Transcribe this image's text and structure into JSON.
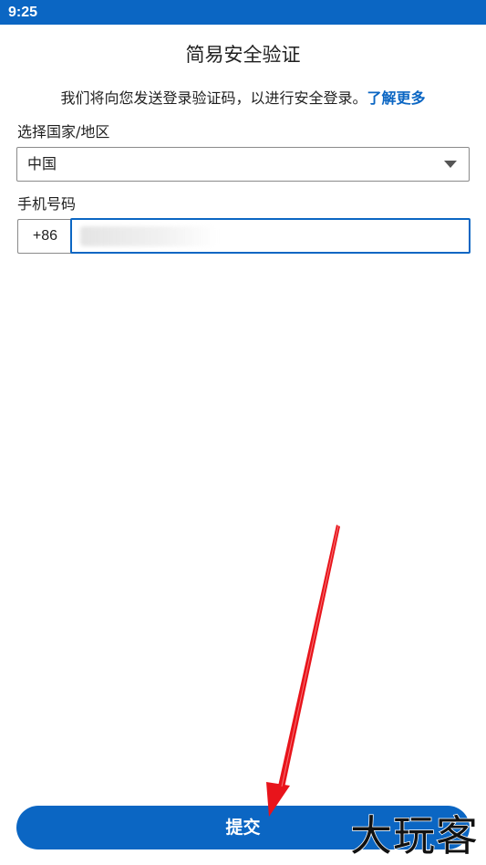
{
  "status_bar": {
    "time": "9:25"
  },
  "header": {
    "title": "简易安全验证"
  },
  "description": {
    "text": "我们将向您发送登录验证码，以进行安全登录。",
    "learn_more": "了解更多"
  },
  "country": {
    "label": "选择国家/地区",
    "selected": "中国"
  },
  "phone": {
    "label": "手机号码",
    "country_code": "+86",
    "value": ""
  },
  "submit": {
    "label": "提交"
  },
  "watermark": {
    "text": "大玩客"
  },
  "colors": {
    "brand_blue": "#0b66c3",
    "annotation_arrow": "#e8141b"
  },
  "icons": {
    "dropdown": "caret-down-icon",
    "annotation": "red-arrow-icon"
  }
}
